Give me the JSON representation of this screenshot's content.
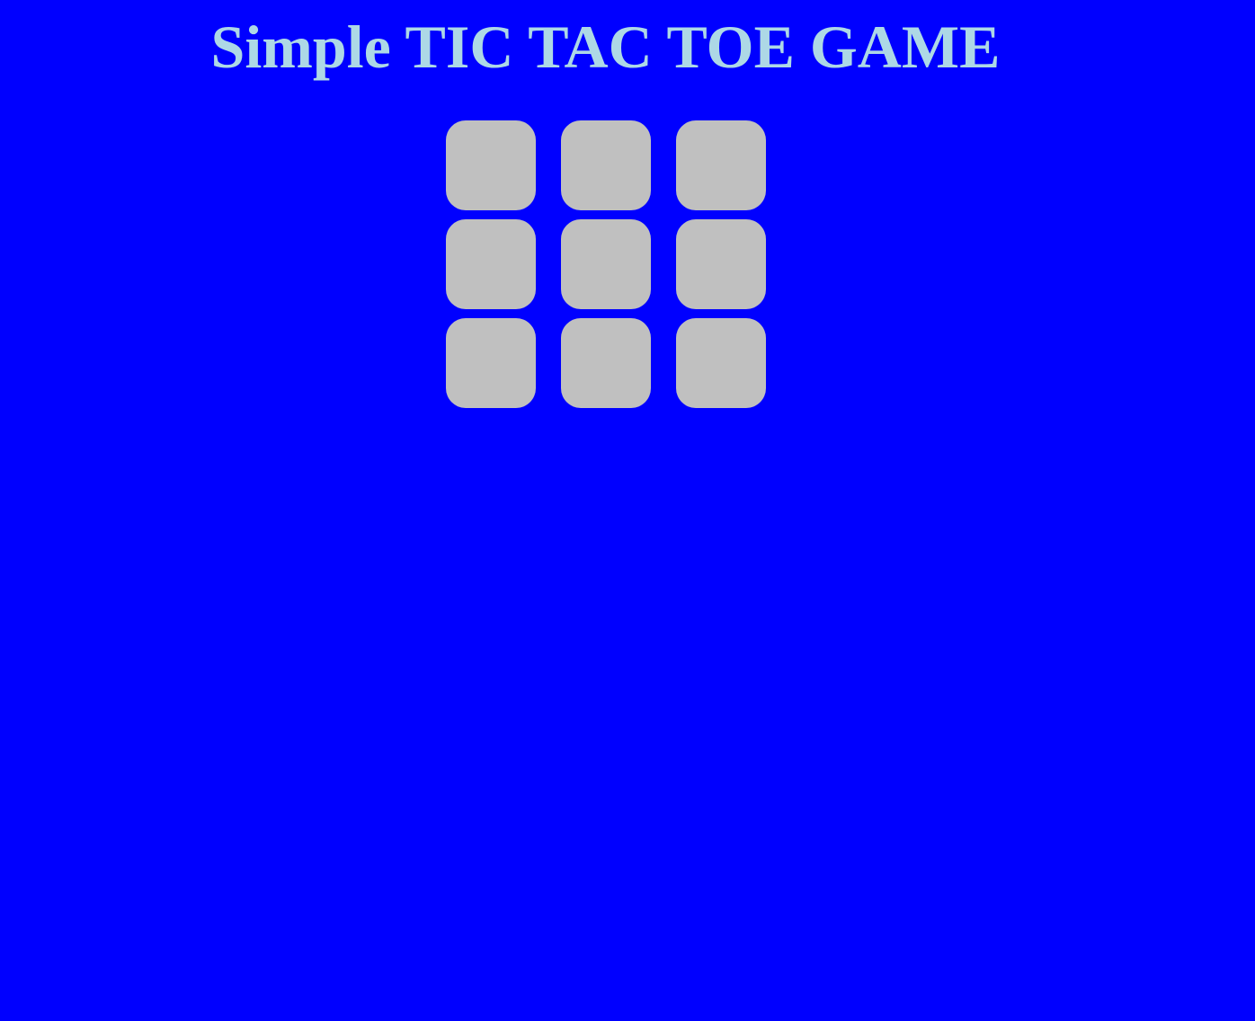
{
  "header": {
    "title": "Simple TIC TAC TOE GAME"
  },
  "board": {
    "cells": [
      "",
      "",
      "",
      "",
      "",
      "",
      "",
      "",
      ""
    ]
  },
  "colors": {
    "background": "#0000ff",
    "title": "#add8e6",
    "cell": "#c0c0c0"
  }
}
